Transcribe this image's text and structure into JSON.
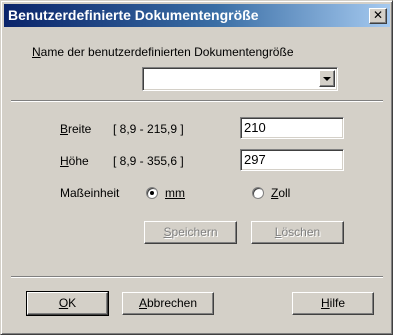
{
  "window": {
    "title": "Benutzerdefinierte Dokumentengröße",
    "close_glyph": "✕",
    "close_icon": "close-icon"
  },
  "name_section": {
    "label_mnemonic": "N",
    "label_rest": "ame der benutzerdefinierten Dokumentengröße",
    "dropdown_value": "",
    "dropdown_icon": "chevron-down-icon"
  },
  "width": {
    "label_mnemonic": "B",
    "label_rest": "reite",
    "range": "[  8,9  -  215,9 ]",
    "value": "210"
  },
  "height": {
    "label_mnemonic": "H",
    "label_rest": "öhe",
    "range": "[  8,9  -  355,6 ]",
    "value": "297"
  },
  "unit": {
    "label": "Maßeinheit",
    "mm_label": "mm",
    "zoll_mnemonic": "Z",
    "zoll_rest": "oll",
    "selected": "mm"
  },
  "actions": {
    "save_mnemonic": "S",
    "save_rest": "peichern",
    "delete_mnemonic": "L",
    "delete_rest": "öschen"
  },
  "footer": {
    "ok_mnemonic": "O",
    "ok_rest": "K",
    "cancel_mnemonic": "A",
    "cancel_rest": "bbrechen",
    "help_mnemonic": "H",
    "help_rest": "ilfe"
  },
  "colors": {
    "face": "#d4d0c8",
    "title_start": "#0a246a",
    "title_end": "#a6caf0",
    "disabled_text": "#808080"
  }
}
